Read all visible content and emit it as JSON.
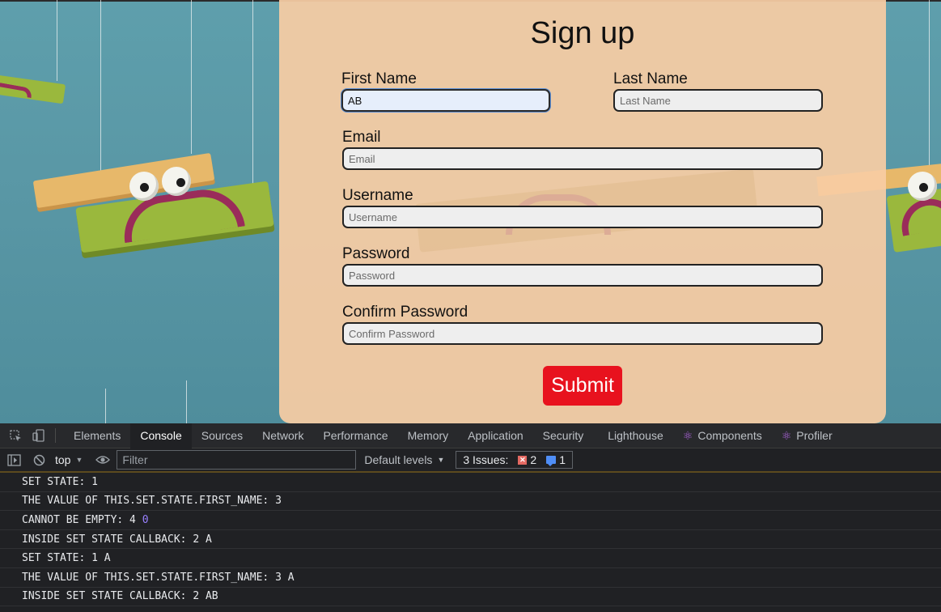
{
  "form": {
    "title": "Sign up",
    "first_name": {
      "label": "First Name",
      "value": "AB",
      "placeholder": "First Name"
    },
    "last_name": {
      "label": "Last Name",
      "value": "",
      "placeholder": "Last Name"
    },
    "email": {
      "label": "Email",
      "value": "",
      "placeholder": "Email"
    },
    "username": {
      "label": "Username",
      "value": "",
      "placeholder": "Username"
    },
    "password": {
      "label": "Password",
      "value": "",
      "placeholder": "Password"
    },
    "confirm_password": {
      "label": "Confirm Password",
      "value": "",
      "placeholder": "Confirm Password"
    },
    "submit_label": "Submit",
    "submit_color": "#e8121e"
  },
  "devtools": {
    "tabs": [
      {
        "label": "Elements"
      },
      {
        "label": "Console",
        "active": true
      },
      {
        "label": "Sources"
      },
      {
        "label": "Network"
      },
      {
        "label": "Performance"
      },
      {
        "label": "Memory"
      },
      {
        "label": "Application"
      },
      {
        "label": "Security"
      },
      {
        "label": "Lighthouse"
      },
      {
        "label": "Components",
        "icon": "react-icon"
      },
      {
        "label": "Profiler",
        "icon": "react-icon"
      }
    ],
    "toolbar": {
      "context": "top",
      "filter_placeholder": "Filter",
      "levels": "Default levels",
      "issues_label": "3 Issues:",
      "error_count": "2",
      "info_count": "1"
    },
    "console_lines": [
      {
        "text": "SET STATE: 1",
        "extra": ""
      },
      {
        "text": "THE VALUE OF THIS.SET.STATE.FIRST_NAME: 3",
        "extra": ""
      },
      {
        "text": "CANNOT BE EMPTY: 4",
        "extra": "0"
      },
      {
        "text": "INSIDE SET STATE CALLBACK: 2 A",
        "extra": ""
      },
      {
        "text": "SET STATE: 1 A",
        "extra": ""
      },
      {
        "text": "THE VALUE OF THIS.SET.STATE.FIRST_NAME: 3 A",
        "extra": ""
      },
      {
        "text": "INSIDE SET STATE CALLBACK: 2 AB",
        "extra": ""
      }
    ]
  }
}
